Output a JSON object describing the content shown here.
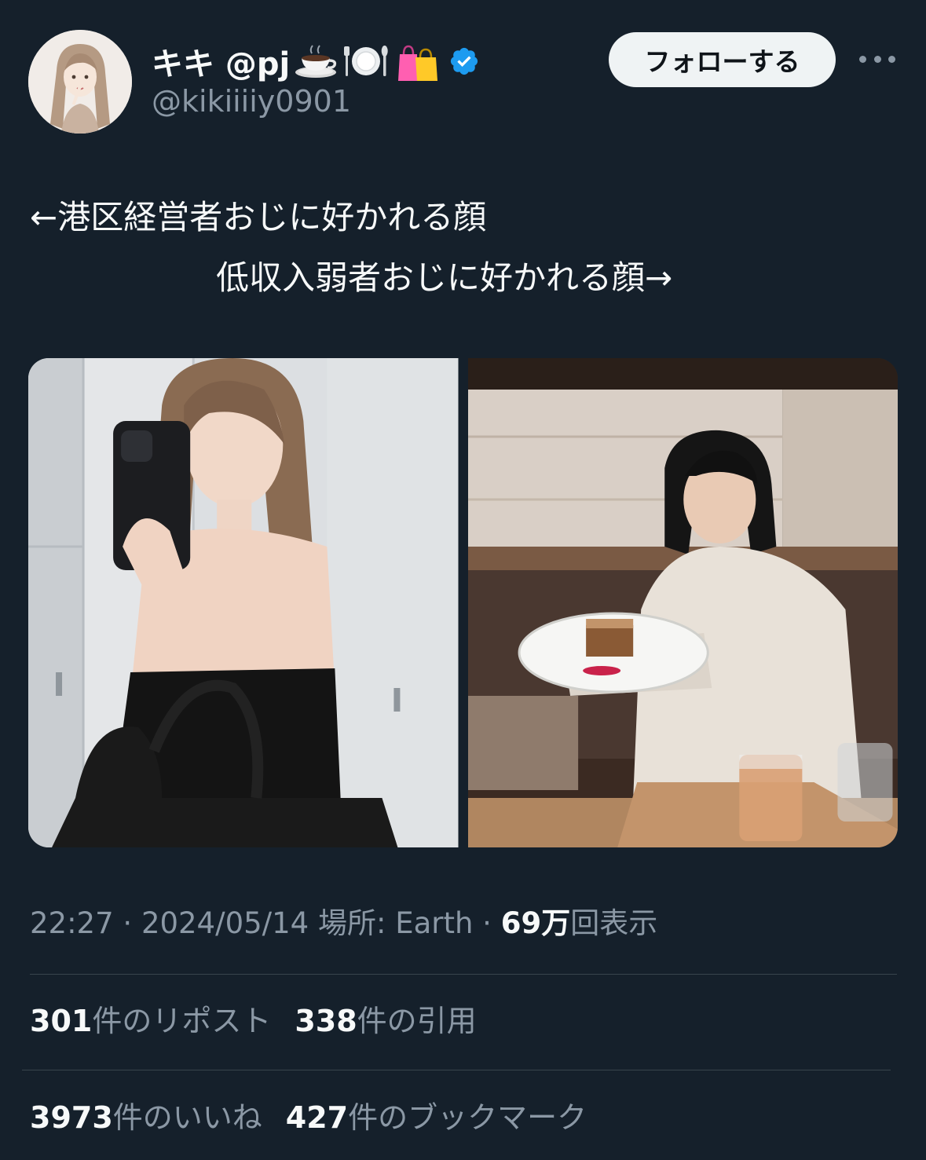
{
  "author": {
    "display_name": "キキ @pj",
    "name_emojis": [
      "coffee-cup-icon",
      "plate-cutlery-icon",
      "shopping-bag-icon"
    ],
    "verified": true,
    "handle": "@kikiiiiy0901"
  },
  "actions": {
    "follow_label": "フォローする",
    "more_icon": "more-dots-icon"
  },
  "tweet": {
    "line1": "←港区経営者おじに好かれる顔",
    "line2": "低収入弱者おじに好かれる顔→"
  },
  "meta": {
    "time": "22:27",
    "sep1": " · ",
    "date": "2024/05/14",
    "location": " 場所: Earth",
    "sep2": " · ",
    "views_count": "69万",
    "views_label": "回表示"
  },
  "stats": {
    "reposts": {
      "count": "301",
      "label": "件のリポスト"
    },
    "quotes": {
      "count": "338",
      "label": "件の引用"
    },
    "likes": {
      "count": "3973",
      "label": "件のいいね"
    },
    "bookmarks": {
      "count": "427",
      "label": "件のブックマーク"
    }
  },
  "colors": {
    "background": "#15202b",
    "text": "#f7f9f9",
    "secondary": "#8b98a5",
    "verified": "#1d9bf0",
    "divider": "#38444d",
    "follow_bg": "#eff3f4"
  }
}
